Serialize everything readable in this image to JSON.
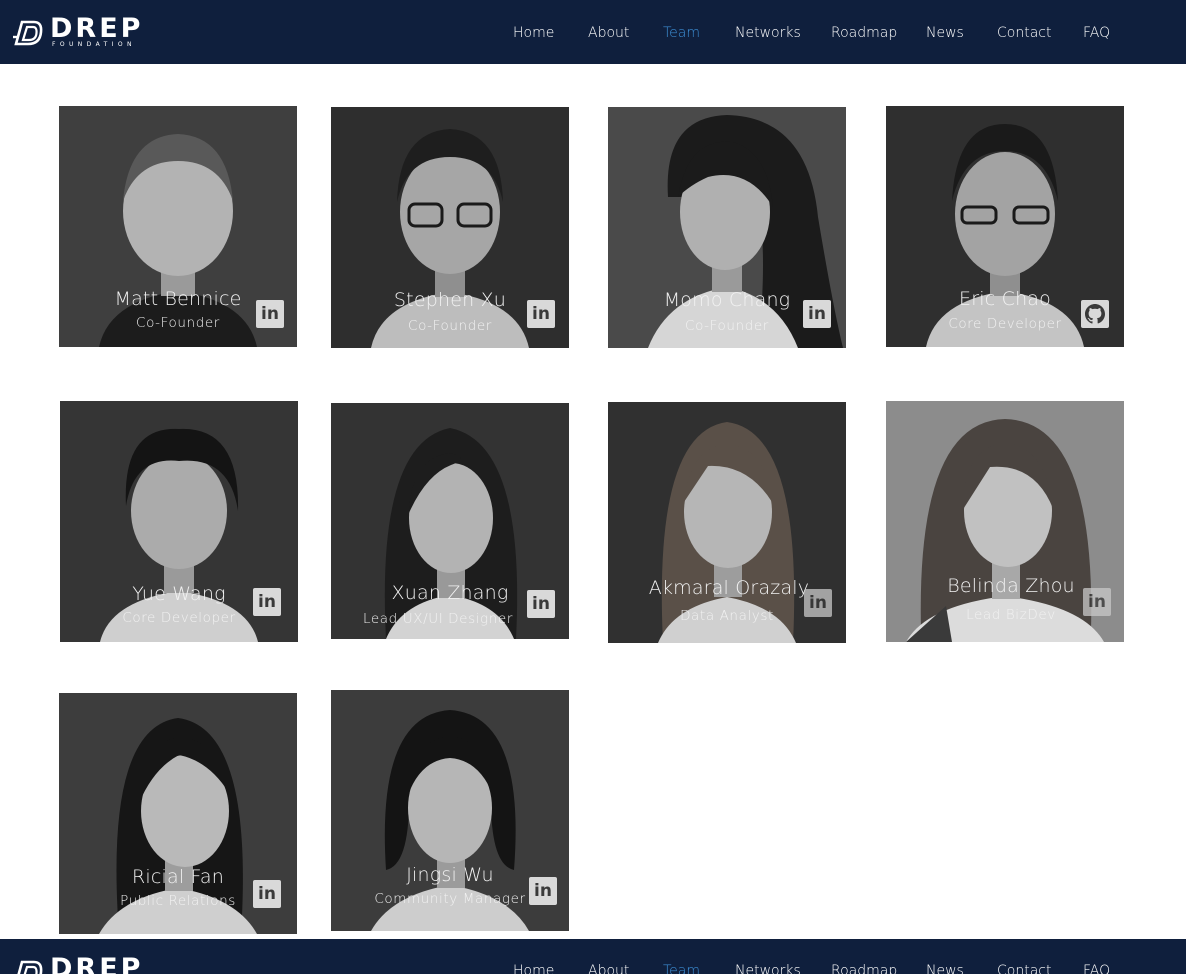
{
  "brand": {
    "name": "DREP",
    "subtitle": "FOUNDATION"
  },
  "nav": {
    "items": [
      {
        "label": "Home",
        "active": false
      },
      {
        "label": "About",
        "active": false
      },
      {
        "label": "Team",
        "active": true
      },
      {
        "label": "Networks",
        "active": false
      },
      {
        "label": "Roadmap",
        "active": false
      },
      {
        "label": "News",
        "active": false
      },
      {
        "label": "Contact",
        "active": false
      },
      {
        "label": "FAQ",
        "active": false
      }
    ]
  },
  "colors": {
    "nav_bg": "#0f1f3d",
    "active_link": "#3d8fd6",
    "text_light": "#f2f2f2"
  },
  "team": [
    {
      "name": "Matt Bennice",
      "role": "Co-Founder",
      "social": "linkedin-icon"
    },
    {
      "name": "Stephen Xu",
      "role": "Co-Founder",
      "social": "linkedin-icon"
    },
    {
      "name": "Momo Chang",
      "role": "Co-Founder",
      "social": "linkedin-icon"
    },
    {
      "name": "Eric Chao",
      "role": "Core Developer",
      "social": "github-icon"
    },
    {
      "name": "Yue Wang",
      "role": "Core Developer",
      "social": "linkedin-icon"
    },
    {
      "name": "Xuan Zhang",
      "role": "Lead UX/UI Designer",
      "social": "linkedin-icon"
    },
    {
      "name": "Akmaral Orazaly",
      "role": "Data Analyst",
      "social": "linkedin-icon"
    },
    {
      "name": "Belinda Zhou",
      "role": "Lead BizDev",
      "social": "linkedin-icon"
    },
    {
      "name": "Ricial Fan",
      "role": "Public Relations",
      "social": "linkedin-icon"
    },
    {
      "name": "Jingsi Wu",
      "role": "Community Manager",
      "social": "linkedin-icon"
    }
  ]
}
